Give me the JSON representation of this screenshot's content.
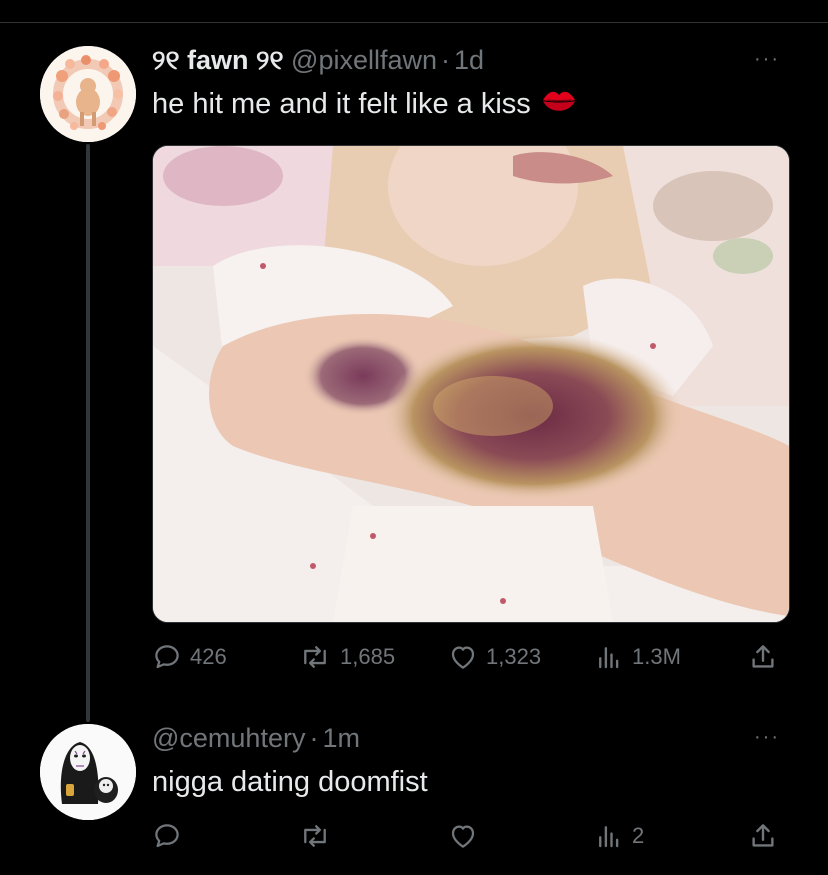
{
  "tweet": {
    "display_name": "୨୧ fawn ୨୧",
    "handle": "@pixellfawn",
    "separator": "·",
    "time": "1d",
    "text": "he hit me and it felt like a kiss",
    "emoji_icon": "kiss-lips-icon",
    "media_alt_icon": "photo",
    "stats": {
      "replies": "426",
      "reposts": "1,685",
      "likes": "1,323",
      "views": "1.3M"
    }
  },
  "reply": {
    "display_name": "",
    "handle": "@cemuhtery",
    "separator": "·",
    "time": "1m",
    "text": "nigga dating doomfist",
    "stats": {
      "replies": "",
      "reposts": "",
      "likes": "",
      "views": "2"
    }
  },
  "more_label": "···",
  "colors": {
    "background": "#000000",
    "text_primary": "#e7e9ea",
    "text_secondary": "#71767b",
    "divider": "#2f3336"
  }
}
